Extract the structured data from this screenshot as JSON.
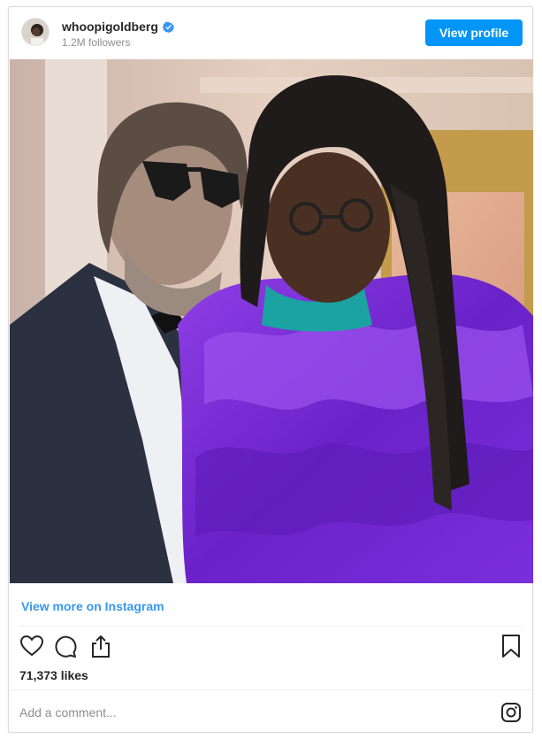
{
  "header": {
    "username": "whoopigoldberg",
    "followers": "1.2M followers",
    "view_profile_label": "View profile"
  },
  "footer": {
    "view_more_label": "View more on Instagram",
    "likes": "71,373 likes",
    "comment_placeholder": "Add a comment..."
  },
  "icons": {
    "verified": "verified-badge-icon",
    "like": "heart-icon",
    "comment": "comment-bubble-icon",
    "share": "share-icon",
    "save": "bookmark-icon",
    "instagram": "instagram-logo-icon"
  },
  "colors": {
    "accent": "#0095f6",
    "link": "#3897f0",
    "text": "#262626",
    "muted": "#8e8e8e",
    "dress": "#7b2fd6"
  }
}
